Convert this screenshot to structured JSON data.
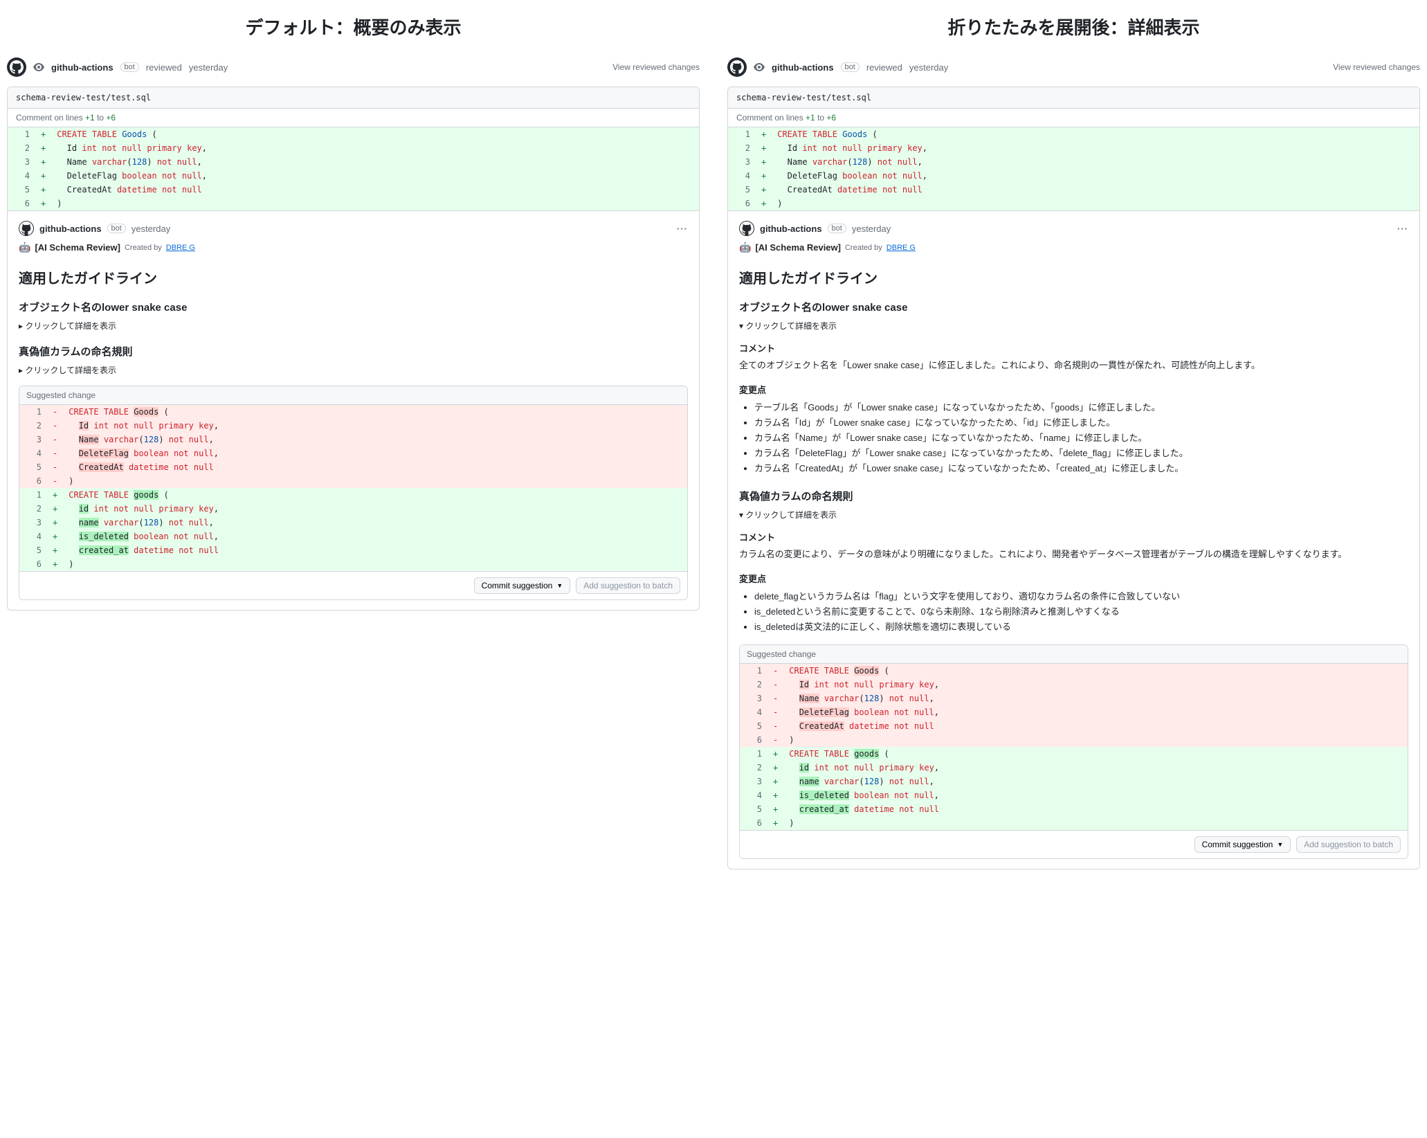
{
  "titles": {
    "left": "デフォルト：概要のみ表示",
    "right": "折りたたみを展開後：詳細表示"
  },
  "review": {
    "actor": "github-actions",
    "bot_badge": "bot",
    "action_text": "reviewed",
    "time": "yesterday",
    "view_changes": "View reviewed changes"
  },
  "file": {
    "path": "schema-review-test/test.sql",
    "range_prefix": "Comment on lines ",
    "range_from": "+1",
    "range_to": " to ",
    "range_end": "+6"
  },
  "diff_original": [
    {
      "n": "1",
      "m": "+",
      "tokens": [
        [
          "kw-red",
          "CREATE"
        ],
        [
          "",
          " "
        ],
        [
          "kw-red",
          "TABLE"
        ],
        [
          "",
          " "
        ],
        [
          "kw-blue",
          "Goods"
        ],
        [
          "",
          " ("
        ]
      ]
    },
    {
      "n": "2",
      "m": "+",
      "tokens": [
        [
          "",
          "  Id "
        ],
        [
          "kw-red",
          "int"
        ],
        [
          "",
          " "
        ],
        [
          "kw-red",
          "not null"
        ],
        [
          "",
          " "
        ],
        [
          "kw-red",
          "primary key"
        ],
        [
          "",
          ","
        ]
      ]
    },
    {
      "n": "3",
      "m": "+",
      "tokens": [
        [
          "",
          "  Name "
        ],
        [
          "kw-red",
          "varchar"
        ],
        [
          "",
          "("
        ],
        [
          "num",
          "128"
        ],
        [
          "",
          ") "
        ],
        [
          "kw-red",
          "not null"
        ],
        [
          "",
          ","
        ]
      ]
    },
    {
      "n": "4",
      "m": "+",
      "tokens": [
        [
          "",
          "  DeleteFlag "
        ],
        [
          "kw-red",
          "boolean"
        ],
        [
          "",
          " "
        ],
        [
          "kw-red",
          "not null"
        ],
        [
          "",
          ","
        ]
      ]
    },
    {
      "n": "5",
      "m": "+",
      "tokens": [
        [
          "",
          "  CreatedAt "
        ],
        [
          "kw-red",
          "datetime"
        ],
        [
          "",
          " "
        ],
        [
          "kw-red",
          "not null"
        ]
      ]
    },
    {
      "n": "6",
      "m": "+",
      "tokens": [
        [
          "",
          ")"
        ]
      ]
    }
  ],
  "comment": {
    "actor": "github-actions",
    "bot_badge": "bot",
    "time": "yesterday",
    "robot": "🤖",
    "title": "[AI Schema Review]",
    "created_by_label": "Created by",
    "created_by_link": "DBRE G"
  },
  "sections": {
    "applied_guidelines": "適用したガイドライン",
    "rule1_title": "オブジェクト名のlower snake case",
    "rule2_title": "真偽値カラムの命名規則",
    "click_to_expand": "クリックして詳細を表示",
    "comment_heading": "コメント",
    "changes_heading": "変更点"
  },
  "rule1_detail": {
    "comment": "全てのオブジェクト名を「Lower snake case」に修正しました。これにより、命名規則の一貫性が保たれ、可読性が向上します。",
    "bullets": [
      "テーブル名「Goods」が「Lower snake case」になっていなかったため、「goods」に修正しました。",
      "カラム名「Id」が「Lower snake case」になっていなかったため、「id」に修正しました。",
      "カラム名「Name」が「Lower snake case」になっていなかったため、「name」に修正しました。",
      "カラム名「DeleteFlag」が「Lower snake case」になっていなかったため、「delete_flag」に修正しました。",
      "カラム名「CreatedAt」が「Lower snake case」になっていなかったため、「created_at」に修正しました。"
    ]
  },
  "rule2_detail": {
    "comment": "カラム名の変更により、データの意味がより明確になりました。これにより、開発者やデータベース管理者がテーブルの構造を理解しやすくなります。",
    "bullets": [
      "delete_flagというカラム名は「flag」という文字を使用しており、適切なカラム名の条件に合致していない",
      "is_deletedという名前に変更することで、0なら未削除、1なら削除済みと推測しやすくなる",
      "is_deletedは英文法的に正しく、削除状態を適切に表現している"
    ]
  },
  "suggest": {
    "header": "Suggested change",
    "commit_btn": "Commit suggestion",
    "add_batch_btn": "Add suggestion to batch"
  },
  "suggest_diff": {
    "removed": [
      {
        "n": "1",
        "tokens": [
          [
            "kw-red",
            "CREATE"
          ],
          [
            "",
            " "
          ],
          [
            "kw-red",
            "TABLE"
          ],
          [
            "",
            " "
          ],
          [
            "hl-del",
            "Goods"
          ],
          [
            "",
            " ("
          ]
        ]
      },
      {
        "n": "2",
        "tokens": [
          [
            "",
            "  "
          ],
          [
            "hl-del",
            "Id"
          ],
          [
            "",
            " "
          ],
          [
            "kw-red",
            "int"
          ],
          [
            "",
            " "
          ],
          [
            "kw-red",
            "not null"
          ],
          [
            "",
            " "
          ],
          [
            "kw-red",
            "primary key"
          ],
          [
            "",
            ","
          ]
        ]
      },
      {
        "n": "3",
        "tokens": [
          [
            "",
            "  "
          ],
          [
            "hl-del",
            "Name"
          ],
          [
            "",
            " "
          ],
          [
            "kw-red",
            "varchar"
          ],
          [
            "",
            "("
          ],
          [
            "num",
            "128"
          ],
          [
            "",
            ") "
          ],
          [
            "kw-red",
            "not null"
          ],
          [
            "",
            ","
          ]
        ]
      },
      {
        "n": "4",
        "tokens": [
          [
            "",
            "  "
          ],
          [
            "hl-del",
            "DeleteFlag"
          ],
          [
            "",
            " "
          ],
          [
            "kw-red",
            "boolean"
          ],
          [
            "",
            " "
          ],
          [
            "kw-red",
            "not null"
          ],
          [
            "",
            ","
          ]
        ]
      },
      {
        "n": "5",
        "tokens": [
          [
            "",
            "  "
          ],
          [
            "hl-del",
            "CreatedAt"
          ],
          [
            "",
            " "
          ],
          [
            "kw-red",
            "datetime"
          ],
          [
            "",
            " "
          ],
          [
            "kw-red",
            "not null"
          ]
        ]
      },
      {
        "n": "6",
        "tokens": [
          [
            "",
            ")"
          ]
        ]
      }
    ],
    "added": [
      {
        "n": "1",
        "tokens": [
          [
            "kw-red",
            "CREATE"
          ],
          [
            "",
            " "
          ],
          [
            "kw-red",
            "TABLE"
          ],
          [
            "",
            " "
          ],
          [
            "hl-add",
            "goods"
          ],
          [
            "",
            " ("
          ]
        ]
      },
      {
        "n": "2",
        "tokens": [
          [
            "",
            "  "
          ],
          [
            "hl-add",
            "id"
          ],
          [
            "",
            " "
          ],
          [
            "kw-red",
            "int"
          ],
          [
            "",
            " "
          ],
          [
            "kw-red",
            "not null"
          ],
          [
            "",
            " "
          ],
          [
            "kw-red",
            "primary key"
          ],
          [
            "",
            ","
          ]
        ]
      },
      {
        "n": "3",
        "tokens": [
          [
            "",
            "  "
          ],
          [
            "hl-add",
            "name"
          ],
          [
            "",
            " "
          ],
          [
            "kw-red",
            "varchar"
          ],
          [
            "",
            "("
          ],
          [
            "num",
            "128"
          ],
          [
            "",
            ") "
          ],
          [
            "kw-red",
            "not null"
          ],
          [
            "",
            ","
          ]
        ]
      },
      {
        "n": "4",
        "tokens": [
          [
            "",
            "  "
          ],
          [
            "hl-add",
            "is_deleted"
          ],
          [
            "",
            " "
          ],
          [
            "kw-red",
            "boolean"
          ],
          [
            "",
            " "
          ],
          [
            "kw-red",
            "not null"
          ],
          [
            "",
            ","
          ]
        ]
      },
      {
        "n": "5",
        "tokens": [
          [
            "",
            "  "
          ],
          [
            "hl-add",
            "created_at"
          ],
          [
            "",
            " "
          ],
          [
            "kw-red",
            "datetime"
          ],
          [
            "",
            " "
          ],
          [
            "kw-red",
            "not null"
          ]
        ]
      },
      {
        "n": "6",
        "tokens": [
          [
            "",
            ")"
          ]
        ]
      }
    ]
  }
}
